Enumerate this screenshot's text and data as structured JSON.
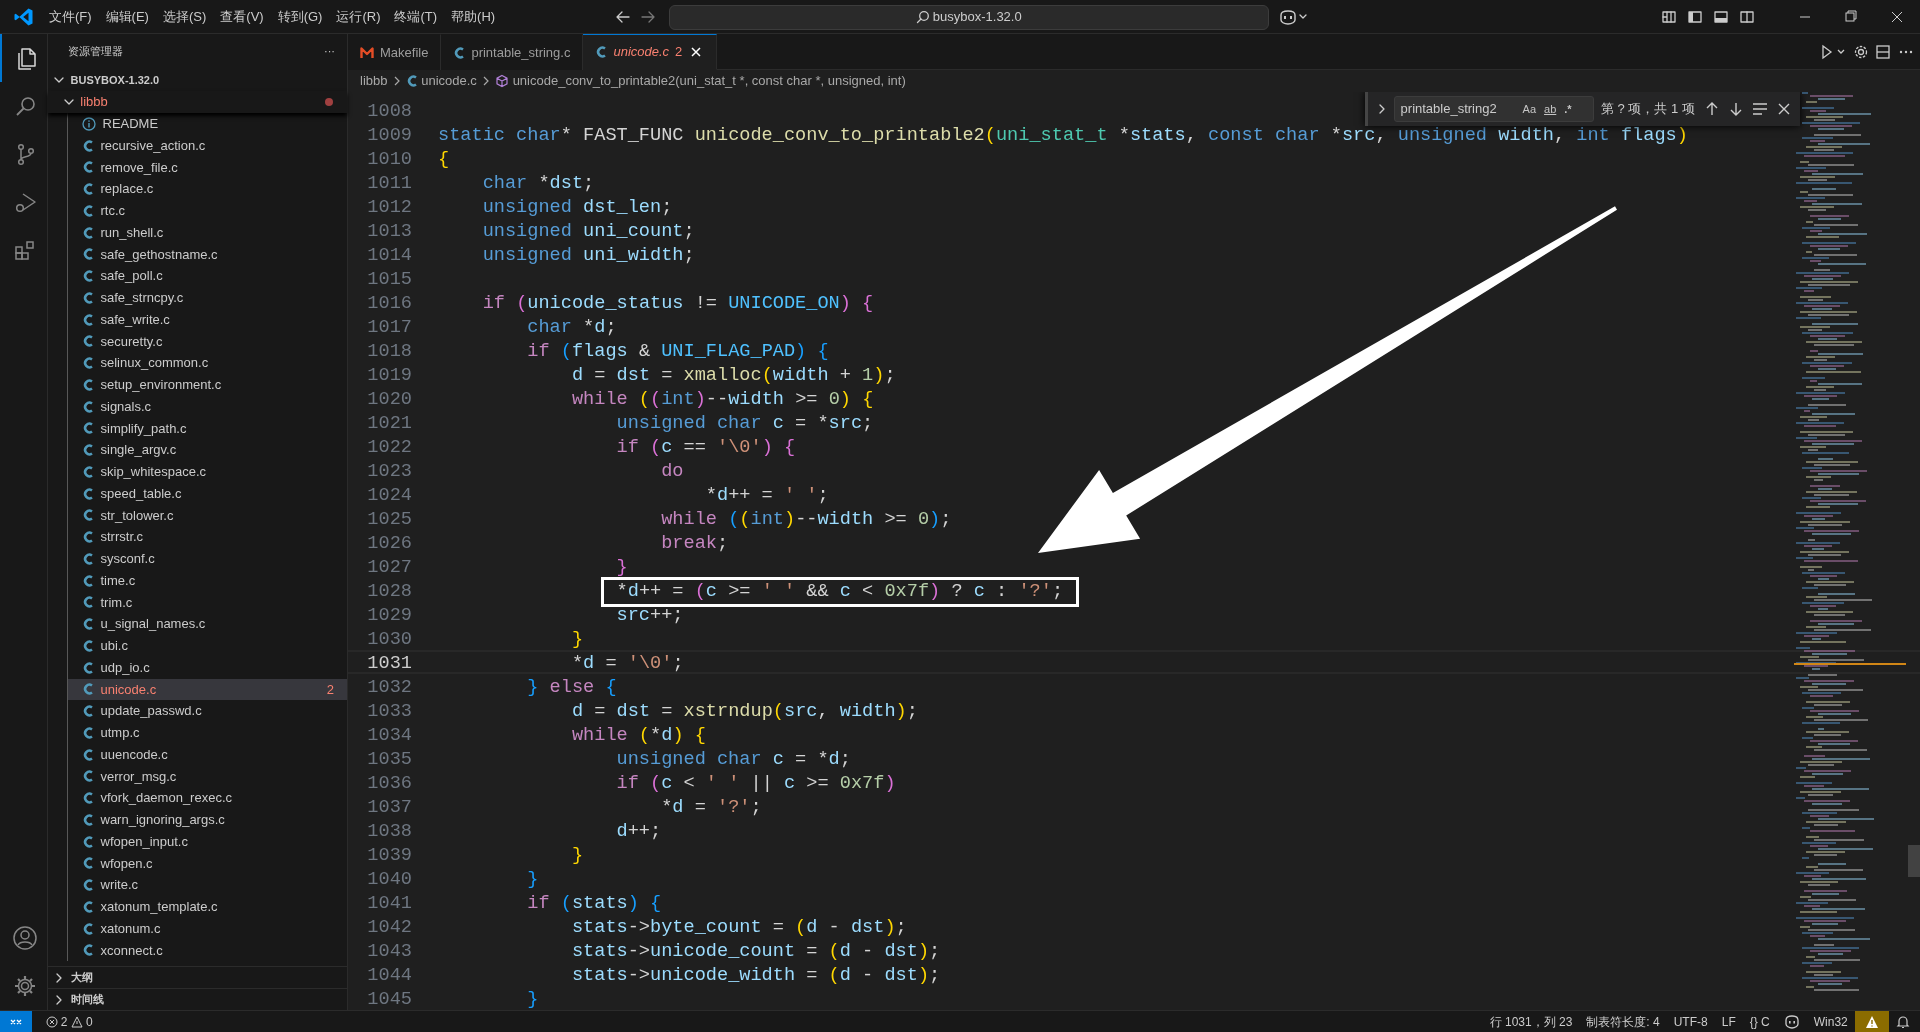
{
  "title_bar": {
    "menus": [
      "文件(F)",
      "编辑(E)",
      "选择(S)",
      "查看(V)",
      "转到(G)",
      "运行(R)",
      "终端(T)",
      "帮助(H)"
    ],
    "search": "busybox-1.32.0"
  },
  "activity_bar": {
    "items": [
      {
        "selected": true
      },
      {
        "selected": false
      },
      {
        "selected": false
      },
      {
        "selected": false
      },
      {
        "selected": false
      }
    ]
  },
  "explorer": {
    "title": "资源管理器",
    "more": "···",
    "root": {
      "label": "BUSYBOX-1.32.0",
      "expanded": true,
      "children": [
        {
          "label": "libbb",
          "expanded": true,
          "modified": true,
          "children": [
            {
              "label": "README",
              "kind": "info",
              "selected": false
            },
            {
              "label": "recursive_action.c",
              "kind": "c",
              "selected": false
            },
            {
              "label": "remove_file.c",
              "kind": "c",
              "selected": false
            },
            {
              "label": "replace.c",
              "kind": "c",
              "selected": false
            },
            {
              "label": "rtc.c",
              "kind": "c",
              "selected": false
            },
            {
              "label": "run_shell.c",
              "kind": "c",
              "selected": false
            },
            {
              "label": "safe_gethostname.c",
              "kind": "c",
              "selected": false
            },
            {
              "label": "safe_poll.c",
              "kind": "c",
              "selected": false
            },
            {
              "label": "safe_strncpy.c",
              "kind": "c",
              "selected": false
            },
            {
              "label": "safe_write.c",
              "kind": "c",
              "selected": false
            },
            {
              "label": "securetty.c",
              "kind": "c",
              "selected": false
            },
            {
              "label": "selinux_common.c",
              "kind": "c",
              "selected": false
            },
            {
              "label": "setup_environment.c",
              "kind": "c",
              "selected": false
            },
            {
              "label": "signals.c",
              "kind": "c",
              "selected": false
            },
            {
              "label": "simplify_path.c",
              "kind": "c",
              "selected": false
            },
            {
              "label": "single_argv.c",
              "kind": "c",
              "selected": false
            },
            {
              "label": "skip_whitespace.c",
              "kind": "c",
              "selected": false
            },
            {
              "label": "speed_table.c",
              "kind": "c",
              "selected": false
            },
            {
              "label": "str_tolower.c",
              "kind": "c",
              "selected": false
            },
            {
              "label": "strrstr.c",
              "kind": "c",
              "selected": false
            },
            {
              "label": "sysconf.c",
              "kind": "c",
              "selected": false
            },
            {
              "label": "time.c",
              "kind": "c",
              "selected": false
            },
            {
              "label": "trim.c",
              "kind": "c",
              "selected": false
            },
            {
              "label": "u_signal_names.c",
              "kind": "c",
              "selected": false
            },
            {
              "label": "ubi.c",
              "kind": "c",
              "selected": false
            },
            {
              "label": "udp_io.c",
              "kind": "c",
              "selected": false
            },
            {
              "label": "unicode.c",
              "kind": "c",
              "selected": true,
              "problems": "2"
            },
            {
              "label": "update_passwd.c",
              "kind": "c",
              "selected": false
            },
            {
              "label": "utmp.c",
              "kind": "c",
              "selected": false
            },
            {
              "label": "uuencode.c",
              "kind": "c",
              "selected": false
            },
            {
              "label": "verror_msg.c",
              "kind": "c",
              "selected": false
            },
            {
              "label": "vfork_daemon_rexec.c",
              "kind": "c",
              "selected": false
            },
            {
              "label": "warn_ignoring_args.c",
              "kind": "c",
              "selected": false
            },
            {
              "label": "wfopen_input.c",
              "kind": "c",
              "selected": false
            },
            {
              "label": "wfopen.c",
              "kind": "c",
              "selected": false
            },
            {
              "label": "write.c",
              "kind": "c",
              "selected": false
            },
            {
              "label": "xatonum_template.c",
              "kind": "c",
              "selected": false
            },
            {
              "label": "xatonum.c",
              "kind": "c",
              "selected": false
            },
            {
              "label": "xconnect.c",
              "kind": "c",
              "selected": false
            }
          ]
        }
      ]
    },
    "sections": [
      {
        "label": "大纲",
        "expanded": false
      },
      {
        "label": "时间线",
        "expanded": false
      }
    ]
  },
  "tabs": [
    {
      "label": "Makefile",
      "kind": "makefile",
      "selected": false
    },
    {
      "label": "printable_string.c",
      "kind": "c",
      "selected": false
    },
    {
      "label": "unicode.c",
      "kind": "c",
      "selected": true,
      "preview": true,
      "problems": "2"
    }
  ],
  "breadcrumb": [
    {
      "label": "libbb",
      "kind": "folder"
    },
    {
      "label": "unicode.c",
      "kind": "c"
    },
    {
      "label": "unicode_conv_to_printable2(uni_stat_t *, const char *, unsigned, int)",
      "kind": "function"
    }
  ],
  "find_widget": {
    "query": "printable_string2",
    "options": [
      {
        "label": "Aa",
        "kind": "case",
        "on": false
      },
      {
        "label": "ab",
        "kind": "word",
        "on": false
      },
      {
        "label": ".*",
        "kind": "regex",
        "on": false
      }
    ],
    "result": "第 ? 项，共 1 项"
  },
  "editor": {
    "lines": [
      {
        "number": "1008",
        "current": false
      },
      {
        "number": "1009",
        "current": false,
        "tokens": [
          {
            "kind": "keyword",
            "text": "static"
          },
          {
            "kind": "keyword",
            "text": " char"
          },
          {
            "kind": "plain",
            "text": "* FAST_FUNC "
          },
          {
            "kind": "function",
            "text": "unicode_conv_to_printable2"
          },
          {
            "kind": "bracket1",
            "text": "("
          },
          {
            "kind": "type",
            "text": "uni_stat_t"
          },
          {
            "kind": "plain",
            "text": " *"
          },
          {
            "kind": "variable",
            "text": "stats"
          },
          {
            "kind": "plain",
            "text": ", "
          },
          {
            "kind": "keyword",
            "text": "const"
          },
          {
            "kind": "keyword",
            "text": " char"
          },
          {
            "kind": "plain",
            "text": " *"
          },
          {
            "kind": "variable",
            "text": "src"
          },
          {
            "kind": "plain",
            "text": ", "
          },
          {
            "kind": "keyword",
            "text": "unsigned"
          },
          {
            "kind": "variable",
            "text": " width"
          },
          {
            "kind": "plain",
            "text": ", "
          },
          {
            "kind": "keyword",
            "text": "int"
          },
          {
            "kind": "variable",
            "text": " flags"
          },
          {
            "kind": "bracket1",
            "text": ")"
          }
        ]
      },
      {
        "number": "1010",
        "current": false,
        "tokens": [
          {
            "kind": "bracket1",
            "text": "{"
          }
        ]
      },
      {
        "number": "1011",
        "current": false,
        "tokens": [
          {
            "kind": "keyword",
            "text": "    char"
          },
          {
            "kind": "plain",
            "text": " *"
          },
          {
            "kind": "variable",
            "text": "dst"
          },
          {
            "kind": "plain",
            "text": ";"
          }
        ]
      },
      {
        "number": "1012",
        "current": false,
        "tokens": [
          {
            "kind": "keyword",
            "text": "    unsigned"
          },
          {
            "kind": "variable",
            "text": " dst_len"
          },
          {
            "kind": "plain",
            "text": ";"
          }
        ]
      },
      {
        "number": "1013",
        "current": false,
        "tokens": [
          {
            "kind": "keyword",
            "text": "    unsigned"
          },
          {
            "kind": "variable",
            "text": " uni_count"
          },
          {
            "kind": "plain",
            "text": ";"
          }
        ]
      },
      {
        "number": "1014",
        "current": false,
        "tokens": [
          {
            "kind": "keyword",
            "text": "    unsigned"
          },
          {
            "kind": "variable",
            "text": " uni_width"
          },
          {
            "kind": "plain",
            "text": ";"
          }
        ]
      },
      {
        "number": "1015",
        "current": false
      },
      {
        "number": "1016",
        "current": false,
        "tokens": [
          {
            "kind": "control",
            "text": "    if"
          },
          {
            "kind": "bracket2",
            "text": " ("
          },
          {
            "kind": "variable",
            "text": "unicode_status"
          },
          {
            "kind": "plain",
            "text": " != "
          },
          {
            "kind": "macro",
            "text": "UNICODE_ON"
          },
          {
            "kind": "bracket2",
            "text": ")"
          },
          {
            "kind": "bracket2",
            "text": " {"
          }
        ]
      },
      {
        "number": "1017",
        "current": false,
        "tokens": [
          {
            "kind": "keyword",
            "text": "        char"
          },
          {
            "kind": "plain",
            "text": " *"
          },
          {
            "kind": "variable",
            "text": "d"
          },
          {
            "kind": "plain",
            "text": ";"
          }
        ]
      },
      {
        "number": "1018",
        "current": false,
        "tokens": [
          {
            "kind": "control",
            "text": "        if"
          },
          {
            "kind": "bracket3",
            "text": " ("
          },
          {
            "kind": "variable",
            "text": "flags"
          },
          {
            "kind": "plain",
            "text": " & "
          },
          {
            "kind": "macro",
            "text": "UNI_FLAG_PAD"
          },
          {
            "kind": "bracket3",
            "text": ")"
          },
          {
            "kind": "bracket3",
            "text": " {"
          }
        ]
      },
      {
        "number": "1019",
        "current": false,
        "tokens": [
          {
            "kind": "variable",
            "text": "            d"
          },
          {
            "kind": "plain",
            "text": " = "
          },
          {
            "kind": "variable",
            "text": "dst"
          },
          {
            "kind": "plain",
            "text": " = "
          },
          {
            "kind": "function",
            "text": "xmalloc"
          },
          {
            "kind": "bracket1",
            "text": "("
          },
          {
            "kind": "variable",
            "text": "width"
          },
          {
            "kind": "plain",
            "text": " + "
          },
          {
            "kind": "number",
            "text": "1"
          },
          {
            "kind": "bracket1",
            "text": ")"
          },
          {
            "kind": "plain",
            "text": ";"
          }
        ]
      },
      {
        "number": "1020",
        "current": false,
        "tokens": [
          {
            "kind": "control",
            "text": "            while"
          },
          {
            "kind": "bracket1",
            "text": " ("
          },
          {
            "kind": "bracket2",
            "text": "("
          },
          {
            "kind": "keyword",
            "text": "int"
          },
          {
            "kind": "bracket2",
            "text": ")"
          },
          {
            "kind": "plain",
            "text": "--"
          },
          {
            "kind": "variable",
            "text": "width"
          },
          {
            "kind": "plain",
            "text": " >= "
          },
          {
            "kind": "number",
            "text": "0"
          },
          {
            "kind": "bracket1",
            "text": ")"
          },
          {
            "kind": "bracket1",
            "text": " {"
          }
        ]
      },
      {
        "number": "1021",
        "current": false,
        "tokens": [
          {
            "kind": "keyword",
            "text": "                unsigned"
          },
          {
            "kind": "keyword",
            "text": " char"
          },
          {
            "kind": "variable",
            "text": " c"
          },
          {
            "kind": "plain",
            "text": " = *"
          },
          {
            "kind": "variable",
            "text": "src"
          },
          {
            "kind": "plain",
            "text": ";"
          }
        ]
      },
      {
        "number": "1022",
        "current": false,
        "tokens": [
          {
            "kind": "control",
            "text": "                if"
          },
          {
            "kind": "bracket2",
            "text": " ("
          },
          {
            "kind": "variable",
            "text": "c"
          },
          {
            "kind": "plain",
            "text": " == "
          },
          {
            "kind": "string",
            "text": "'\\0'"
          },
          {
            "kind": "bracket2",
            "text": ")"
          },
          {
            "kind": "bracket2",
            "text": " {"
          }
        ]
      },
      {
        "number": "1023",
        "current": false,
        "tokens": [
          {
            "kind": "control",
            "text": "                    do"
          }
        ]
      },
      {
        "number": "1024",
        "current": false,
        "tokens": [
          {
            "kind": "plain",
            "text": "                        *"
          },
          {
            "kind": "variable",
            "text": "d"
          },
          {
            "kind": "plain",
            "text": "++ = "
          },
          {
            "kind": "string",
            "text": "' '"
          },
          {
            "kind": "plain",
            "text": ";"
          }
        ]
      },
      {
        "number": "1025",
        "current": false,
        "tokens": [
          {
            "kind": "control",
            "text": "                    while"
          },
          {
            "kind": "bracket3",
            "text": " ("
          },
          {
            "kind": "bracket1",
            "text": "("
          },
          {
            "kind": "keyword",
            "text": "int"
          },
          {
            "kind": "bracket1",
            "text": ")"
          },
          {
            "kind": "plain",
            "text": "--"
          },
          {
            "kind": "variable",
            "text": "width"
          },
          {
            "kind": "plain",
            "text": " >= "
          },
          {
            "kind": "number",
            "text": "0"
          },
          {
            "kind": "bracket3",
            "text": ")"
          },
          {
            "kind": "plain",
            "text": ";"
          }
        ]
      },
      {
        "number": "1026",
        "current": false,
        "tokens": [
          {
            "kind": "control",
            "text": "                    break"
          },
          {
            "kind": "plain",
            "text": ";"
          }
        ]
      },
      {
        "number": "1027",
        "current": false,
        "tokens": [
          {
            "kind": "bracket2",
            "text": "                }"
          }
        ]
      },
      {
        "number": "1028",
        "current": false,
        "boxed": true,
        "tokens": [
          {
            "kind": "plain",
            "text": "                *"
          },
          {
            "kind": "variable",
            "text": "d"
          },
          {
            "kind": "plain",
            "text": "++ = "
          },
          {
            "kind": "bracket2",
            "text": "("
          },
          {
            "kind": "variable",
            "text": "c"
          },
          {
            "kind": "plain",
            "text": " >= "
          },
          {
            "kind": "string",
            "text": "' '"
          },
          {
            "kind": "plain",
            "text": " && "
          },
          {
            "kind": "variable",
            "text": "c"
          },
          {
            "kind": "plain",
            "text": " < "
          },
          {
            "kind": "number",
            "text": "0x7f"
          },
          {
            "kind": "bracket2",
            "text": ")"
          },
          {
            "kind": "plain",
            "text": " ? "
          },
          {
            "kind": "variable",
            "text": "c"
          },
          {
            "kind": "plain",
            "text": " : "
          },
          {
            "kind": "string",
            "text": "'?'"
          },
          {
            "kind": "plain",
            "text": ";"
          }
        ]
      },
      {
        "number": "1029",
        "current": false,
        "tokens": [
          {
            "kind": "variable",
            "text": "                src"
          },
          {
            "kind": "plain",
            "text": "++;"
          }
        ]
      },
      {
        "number": "1030",
        "current": false,
        "tokens": [
          {
            "kind": "bracket1",
            "text": "            }"
          }
        ]
      },
      {
        "number": "1031",
        "current": true,
        "tokens": [
          {
            "kind": "plain",
            "text": "            *"
          },
          {
            "kind": "variable",
            "text": "d"
          },
          {
            "kind": "plain",
            "text": " = "
          },
          {
            "kind": "string",
            "text": "'\\0'"
          },
          {
            "kind": "plain",
            "text": ";"
          }
        ]
      },
      {
        "number": "1032",
        "current": false,
        "tokens": [
          {
            "kind": "bracket3",
            "text": "        }"
          },
          {
            "kind": "control",
            "text": " else"
          },
          {
            "kind": "bracket3",
            "text": " {"
          }
        ]
      },
      {
        "number": "1033",
        "current": false,
        "tokens": [
          {
            "kind": "variable",
            "text": "            d"
          },
          {
            "kind": "plain",
            "text": " = "
          },
          {
            "kind": "variable",
            "text": "dst"
          },
          {
            "kind": "plain",
            "text": " = "
          },
          {
            "kind": "function",
            "text": "xstrndup"
          },
          {
            "kind": "bracket1",
            "text": "("
          },
          {
            "kind": "variable",
            "text": "src"
          },
          {
            "kind": "plain",
            "text": ", "
          },
          {
            "kind": "variable",
            "text": "width"
          },
          {
            "kind": "bracket1",
            "text": ")"
          },
          {
            "kind": "plain",
            "text": ";"
          }
        ]
      },
      {
        "number": "1034",
        "current": false,
        "tokens": [
          {
            "kind": "control",
            "text": "            while"
          },
          {
            "kind": "bracket1",
            "text": " ("
          },
          {
            "kind": "plain",
            "text": "*"
          },
          {
            "kind": "variable",
            "text": "d"
          },
          {
            "kind": "bracket1",
            "text": ")"
          },
          {
            "kind": "bracket1",
            "text": " {"
          }
        ]
      },
      {
        "number": "1035",
        "current": false,
        "tokens": [
          {
            "kind": "keyword",
            "text": "                unsigned"
          },
          {
            "kind": "keyword",
            "text": " char"
          },
          {
            "kind": "variable",
            "text": " c"
          },
          {
            "kind": "plain",
            "text": " = *"
          },
          {
            "kind": "variable",
            "text": "d"
          },
          {
            "kind": "plain",
            "text": ";"
          }
        ]
      },
      {
        "number": "1036",
        "current": false,
        "tokens": [
          {
            "kind": "control",
            "text": "                if"
          },
          {
            "kind": "bracket2",
            "text": " ("
          },
          {
            "kind": "variable",
            "text": "c"
          },
          {
            "kind": "plain",
            "text": " < "
          },
          {
            "kind": "string",
            "text": "' '"
          },
          {
            "kind": "plain",
            "text": " || "
          },
          {
            "kind": "variable",
            "text": "c"
          },
          {
            "kind": "plain",
            "text": " >= "
          },
          {
            "kind": "number",
            "text": "0x7f"
          },
          {
            "kind": "bracket2",
            "text": ")"
          }
        ]
      },
      {
        "number": "1037",
        "current": false,
        "tokens": [
          {
            "kind": "plain",
            "text": "                    *"
          },
          {
            "kind": "variable",
            "text": "d"
          },
          {
            "kind": "plain",
            "text": " = "
          },
          {
            "kind": "string",
            "text": "'?'"
          },
          {
            "kind": "plain",
            "text": ";"
          }
        ]
      },
      {
        "number": "1038",
        "current": false,
        "tokens": [
          {
            "kind": "variable",
            "text": "                d"
          },
          {
            "kind": "plain",
            "text": "++;"
          }
        ]
      },
      {
        "number": "1039",
        "current": false,
        "tokens": [
          {
            "kind": "bracket1",
            "text": "            }"
          }
        ]
      },
      {
        "number": "1040",
        "current": false,
        "tokens": [
          {
            "kind": "bracket3",
            "text": "        }"
          }
        ]
      },
      {
        "number": "1041",
        "current": false,
        "tokens": [
          {
            "kind": "control",
            "text": "        if"
          },
          {
            "kind": "bracket3",
            "text": " ("
          },
          {
            "kind": "variable",
            "text": "stats"
          },
          {
            "kind": "bracket3",
            "text": ")"
          },
          {
            "kind": "bracket3",
            "text": " {"
          }
        ]
      },
      {
        "number": "1042",
        "current": false,
        "tokens": [
          {
            "kind": "variable",
            "text": "            stats"
          },
          {
            "kind": "plain",
            "text": "->"
          },
          {
            "kind": "variable",
            "text": "byte_count"
          },
          {
            "kind": "plain",
            "text": " = "
          },
          {
            "kind": "bracket1",
            "text": "("
          },
          {
            "kind": "variable",
            "text": "d"
          },
          {
            "kind": "plain",
            "text": " - "
          },
          {
            "kind": "variable",
            "text": "dst"
          },
          {
            "kind": "bracket1",
            "text": ")"
          },
          {
            "kind": "plain",
            "text": ";"
          }
        ]
      },
      {
        "number": "1043",
        "current": false,
        "tokens": [
          {
            "kind": "variable",
            "text": "            stats"
          },
          {
            "kind": "plain",
            "text": "->"
          },
          {
            "kind": "variable",
            "text": "unicode_count"
          },
          {
            "kind": "plain",
            "text": " = "
          },
          {
            "kind": "bracket1",
            "text": "("
          },
          {
            "kind": "variable",
            "text": "d"
          },
          {
            "kind": "plain",
            "text": " - "
          },
          {
            "kind": "variable",
            "text": "dst"
          },
          {
            "kind": "bracket1",
            "text": ")"
          },
          {
            "kind": "plain",
            "text": ";"
          }
        ]
      },
      {
        "number": "1044",
        "current": false,
        "tokens": [
          {
            "kind": "variable",
            "text": "            stats"
          },
          {
            "kind": "plain",
            "text": "->"
          },
          {
            "kind": "variable",
            "text": "unicode_width"
          },
          {
            "kind": "plain",
            "text": " = "
          },
          {
            "kind": "bracket1",
            "text": "("
          },
          {
            "kind": "variable",
            "text": "d"
          },
          {
            "kind": "plain",
            "text": " - "
          },
          {
            "kind": "variable",
            "text": "dst"
          },
          {
            "kind": "bracket1",
            "text": ")"
          },
          {
            "kind": "plain",
            "text": ";"
          }
        ]
      },
      {
        "number": "1045",
        "current": false,
        "tokens": [
          {
            "kind": "bracket3",
            "text": "        }"
          }
        ]
      }
    ],
    "annotations": [
      {
        "kind": "arrow"
      }
    ]
  },
  "status_bar": {
    "errors": "2",
    "warnings": "0",
    "items": [
      {
        "kind": "text",
        "label": "行 1031，列 23"
      },
      {
        "kind": "text",
        "label": "制表符长度: 4"
      },
      {
        "kind": "text",
        "label": "UTF-8"
      },
      {
        "kind": "text",
        "label": "LF"
      },
      {
        "kind": "language",
        "label": "{} C"
      },
      {
        "kind": "copilot"
      },
      {
        "kind": "text",
        "label": "Win32"
      },
      {
        "kind": "warning"
      },
      {
        "kind": "bell"
      }
    ]
  }
}
